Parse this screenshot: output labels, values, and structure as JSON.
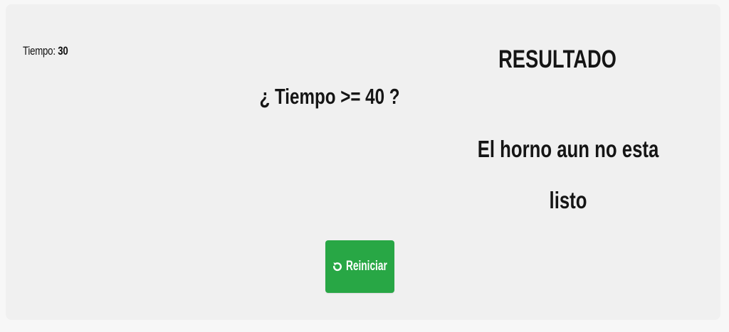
{
  "status": {
    "tiempo_label": "Tiempo:",
    "tiempo_value": "30"
  },
  "condition": {
    "question": "¿ Tiempo >= 40 ?"
  },
  "result": {
    "title": "RESULTADO",
    "message": "El horno aun no esta listo"
  },
  "actions": {
    "restart_label": "Reiniciar",
    "restart_icon": "restart-icon",
    "button_color": "#28a745"
  }
}
